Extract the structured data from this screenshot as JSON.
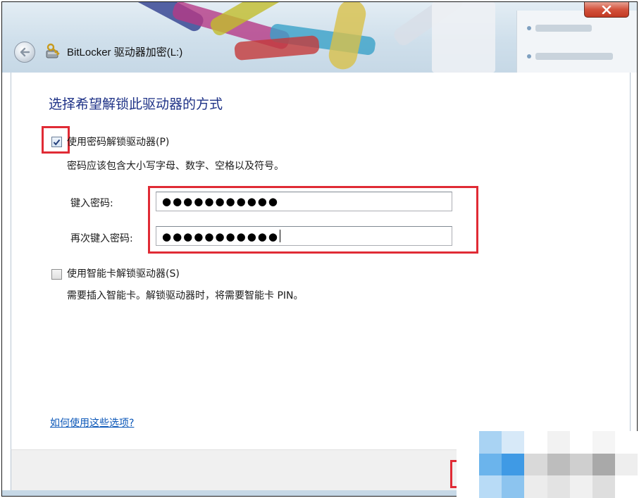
{
  "window": {
    "title": "BitLocker 驱动器加密(L:)",
    "icons": {
      "back": "back-arrow-icon",
      "app": "bitlocker-key-icon",
      "close": "close-icon"
    },
    "colors": {
      "heading": "#1e3287",
      "link": "#0b57b8",
      "highlight": "#e02b35"
    }
  },
  "main": {
    "heading": "选择希望解锁此驱动器的方式",
    "password_option": {
      "label": "使用密码解锁驱动器(P)",
      "checked": true,
      "description": "密码应该包含大小写字母、数字、空格以及符号。",
      "enter_label": "键入密码:",
      "enter_value": "●●●●●●●●●●●",
      "confirm_label": "再次键入密码:",
      "confirm_value": "●●●●●●●●●●●"
    },
    "smartcard_option": {
      "label": "使用智能卡解锁驱动器(S)",
      "checked": false,
      "description": "需要插入智能卡。解锁驱动器时，将需要智能卡 PIN。"
    },
    "help_link": "如何使用这些选项?"
  }
}
